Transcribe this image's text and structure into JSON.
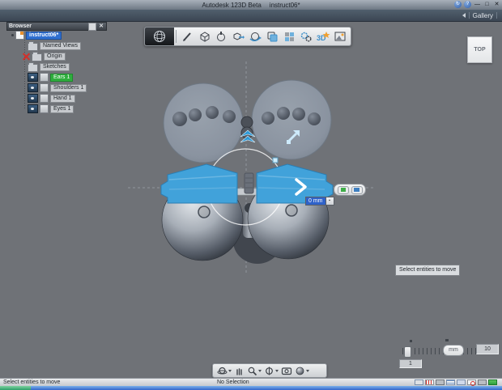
{
  "window": {
    "app_title": "Autodesk 123D Beta",
    "doc_title": "instruct06*",
    "controls": {
      "help": "?",
      "minimize": "—",
      "maximize": "□",
      "close": "✕"
    }
  },
  "menubar": {
    "gallery": "Gallery"
  },
  "browser": {
    "title": "Browser",
    "items": [
      {
        "label": "instruct06*",
        "selected": "blue"
      },
      {
        "label": "Named Views",
        "icon": "folder"
      },
      {
        "label": "Origin",
        "icon": "folder-hidden-red-x"
      },
      {
        "label": "Sketches",
        "icon": "folder"
      },
      {
        "label": "Ears 1",
        "icon": "body-visible",
        "selected": "green"
      },
      {
        "label": "Shoulders 1",
        "icon": "body-visible"
      },
      {
        "label": "Hand 1",
        "icon": "body-visible"
      },
      {
        "label": "Eyes 1",
        "icon": "body-visible"
      }
    ]
  },
  "toolbar": {
    "badge_3d": "3D",
    "icons": [
      "app-menu-sphere",
      "sketch-pen",
      "primitive-cube",
      "spin-top",
      "move-cube",
      "orbit-sphere",
      "combine-solids",
      "pattern-grid",
      "gear-assembly",
      "3d-text-star",
      "scene-material"
    ]
  },
  "viewcube": {
    "label": "TOP"
  },
  "manipulator": {
    "distance_value": "0 mm"
  },
  "tooltip": {
    "text": "Select entities to move"
  },
  "ruler": {
    "unit": "mm",
    "major_value": "10",
    "minor_value": "1"
  },
  "navbar": {
    "icons": [
      "orbit",
      "pan",
      "zoom",
      "constrained-orbit",
      "look-at",
      "display-style"
    ]
  },
  "statusbar": {
    "left": "Select entities to move",
    "center": "No Selection",
    "toggles": [
      "snap-toggle",
      "ruler-toggle",
      "lock-toggle",
      "layers-toggle",
      "osnap-toggle",
      "disable-toggle",
      "pad-toggle",
      "active-indicator"
    ]
  },
  "colors": {
    "accent_blue": "#41a2da",
    "selection_blue": "#2f6fd0",
    "selection_green": "#2fae3e",
    "viewport_gray": "#6f7277"
  }
}
